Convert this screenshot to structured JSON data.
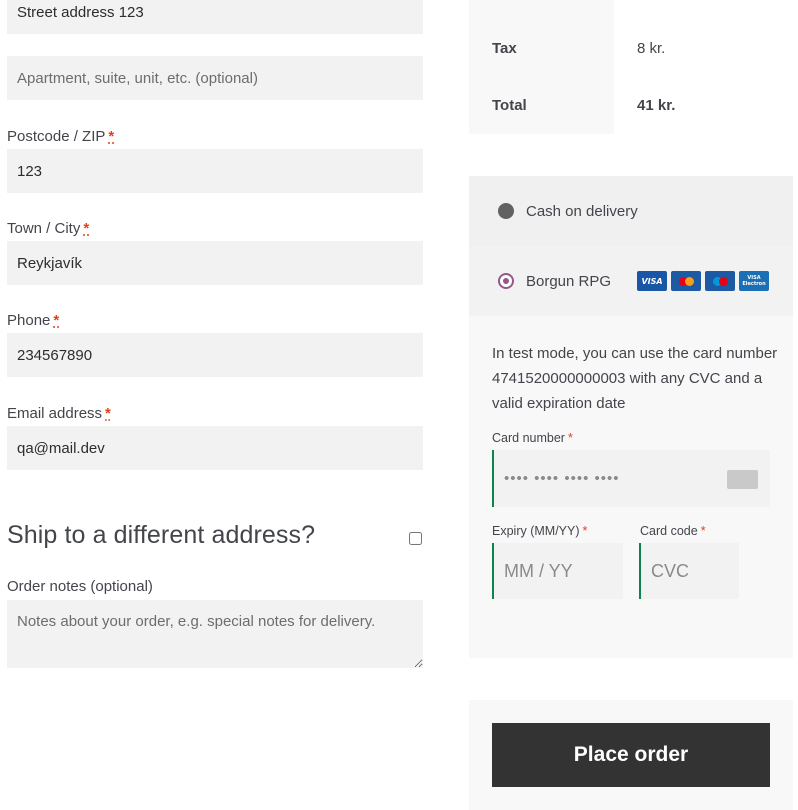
{
  "billing": {
    "street_value": "Street address 123",
    "apartment_placeholder": "Apartment, suite, unit, etc. (optional)",
    "postcode_label": "Postcode / ZIP",
    "postcode_value": "123",
    "city_label": "Town / City",
    "city_value": "Reykjavík",
    "phone_label": "Phone",
    "phone_value": "234567890",
    "email_label": "Email address",
    "email_value": "qa@mail.dev",
    "required_mark": "*"
  },
  "shipping": {
    "heading": "Ship to a different address?",
    "checked": false
  },
  "order_notes": {
    "label": "Order notes (optional)",
    "placeholder": "Notes about your order, e.g. special notes for delivery."
  },
  "totals": {
    "tax_label": "Tax",
    "tax_value": "8 kr.",
    "total_label": "Total",
    "total_value": "41 kr."
  },
  "payment": {
    "methods": [
      {
        "label": "Cash on delivery",
        "selected": false
      },
      {
        "label": "Borgun RPG",
        "selected": true
      }
    ],
    "card_logos": [
      "VISA",
      "mastercard",
      "maestro",
      "VISA Electron"
    ],
    "test_note": "In test mode, you can use the card number 4741520000000003 with any CVC and a valid expiration date",
    "card_number_label": "Card number",
    "card_number_placeholder": "•••• •••• •••• ••••",
    "expiry_label": "Expiry (MM/YY)",
    "expiry_placeholder": "MM / YY",
    "cvc_label": "Card code",
    "cvc_placeholder": "CVC",
    "required_star": "*",
    "accent_color": "#0f834d",
    "radio_color": "#96588a"
  },
  "place_order_label": "Place order"
}
